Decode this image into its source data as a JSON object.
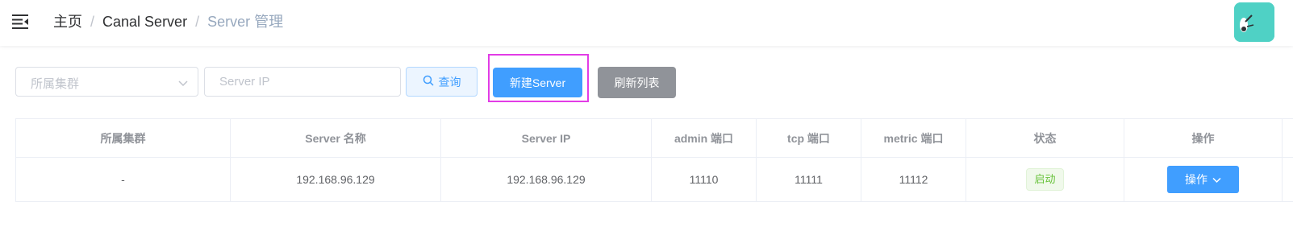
{
  "header": {
    "breadcrumb": [
      "主页",
      "Canal Server",
      "Server 管理"
    ],
    "separator": "/"
  },
  "filters": {
    "cluster_select_placeholder": "所属集群",
    "server_ip_placeholder": "Server IP",
    "query_label": "查询",
    "new_server_label": "新建Server",
    "refresh_label": "刷新列表"
  },
  "table": {
    "columns": [
      "所属集群",
      "Server 名称",
      "Server IP",
      "admin 端口",
      "tcp 端口",
      "metric 端口",
      "状态",
      "操作"
    ],
    "rows": [
      {
        "cluster": "-",
        "name": "192.168.96.129",
        "ip": "192.168.96.129",
        "admin_port": "11110",
        "tcp_port": "11111",
        "metric_port": "11112",
        "status": "启动",
        "action": "操作"
      }
    ]
  },
  "colors": {
    "primary": "#409eff",
    "success": "#67c23a",
    "info": "#909399",
    "highlight": "#e23ce6"
  }
}
